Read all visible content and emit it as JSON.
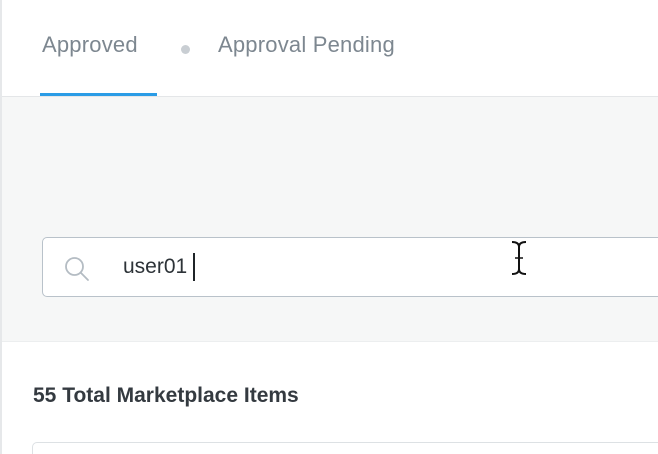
{
  "tabs": [
    {
      "label": "Approved",
      "active": true
    },
    {
      "label": "Approval Pending",
      "active": false
    }
  ],
  "colors": {
    "accent": "#2a9ce6",
    "tab_text": "#7d8790",
    "section_bg": "#f6f7f7"
  },
  "search": {
    "value": "user01",
    "placeholder": "",
    "icon": "search-icon"
  },
  "results": {
    "count_label": "55 Total Marketplace Items"
  }
}
